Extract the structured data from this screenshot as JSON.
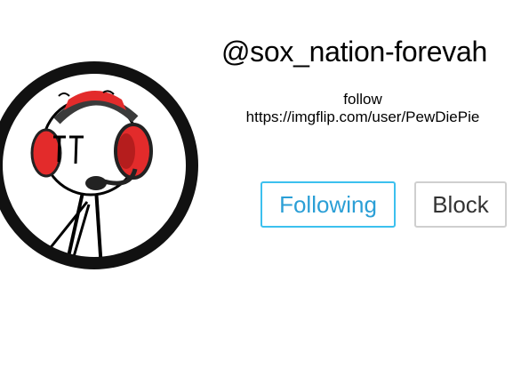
{
  "profile": {
    "username": "@sox_nation-forevah",
    "bio_line1": "follow",
    "bio_line2": "https://imgflip.com/user/PewDiePie"
  },
  "actions": {
    "follow_label": "Following",
    "block_label": "Block"
  },
  "colors": {
    "following_border": "#3cc0ee",
    "following_text": "#2b9fd6",
    "block_border": "#cfcfcf",
    "headset_red": "#e32b2b"
  },
  "avatar": {
    "icon": "stick-figure-headset-avatar"
  }
}
